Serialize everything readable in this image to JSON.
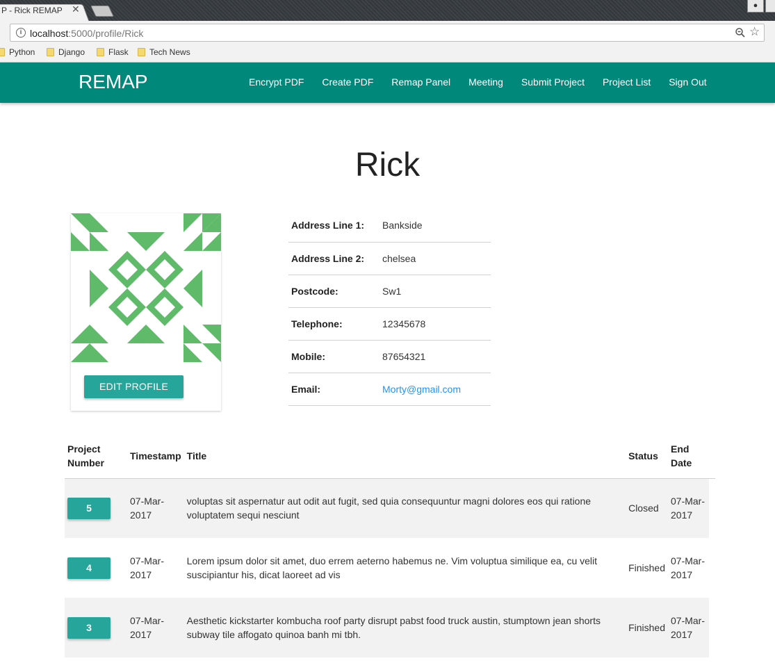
{
  "browser": {
    "tab_title": "P - Rick REMAP",
    "tab_close": "✕",
    "url_host": "localhost",
    "url_rest": ":5000/profile/Rick",
    "bookmarks": [
      "Python",
      "Django",
      "Flask",
      "Tech News"
    ]
  },
  "nav": {
    "brand": "REMAP",
    "links": [
      "Encrypt PDF",
      "Create PDF",
      "Remap Panel",
      "Meeting",
      "Submit Project",
      "Project List",
      "Sign Out"
    ]
  },
  "profile": {
    "name": "Rick",
    "edit_label": "EDIT PROFILE",
    "avatar_color": "#5fbb6a",
    "fields": [
      {
        "label": "Address Line 1:",
        "value": "Bankside"
      },
      {
        "label": "Address Line 2:",
        "value": "chelsea"
      },
      {
        "label": "Postcode:",
        "value": "Sw1"
      },
      {
        "label": "Telephone:",
        "value": "12345678"
      },
      {
        "label": "Mobile:",
        "value": "87654321"
      },
      {
        "label": "Email:",
        "value": "Morty@gmail.com"
      }
    ]
  },
  "projects": {
    "headers": {
      "number": "Project Number",
      "timestamp": "Timestamp",
      "title": "Title",
      "status": "Status",
      "end_date": "End Date"
    },
    "rows": [
      {
        "number": "5",
        "timestamp": "07-Mar-2017",
        "title": "voluptas sit aspernatur aut odit aut fugit, sed quia consequuntur magni dolores eos qui ratione voluptatem sequi nesciunt",
        "status": "Closed",
        "end_date": "07-Mar-2017"
      },
      {
        "number": "4",
        "timestamp": "07-Mar-2017",
        "title": "Lorem ipsum dolor sit amet, duo errem aeterno habemus ne. Vim voluptua similique ea, cu velit suscipiantur his, dicat laoreet ad vis",
        "status": "Finished",
        "end_date": "07-Mar-2017"
      },
      {
        "number": "3",
        "timestamp": "07-Mar-2017",
        "title": "Aesthetic kickstarter kombucha roof party disrupt pabst food truck austin, stumptown jean shorts subway tile affogato quinoa banh mi tbh.",
        "status": "Finished",
        "end_date": "07-Mar-2017"
      }
    ]
  },
  "colors": {
    "nav": "#00897b",
    "button": "#26a69a",
    "link": "#2196f3"
  }
}
